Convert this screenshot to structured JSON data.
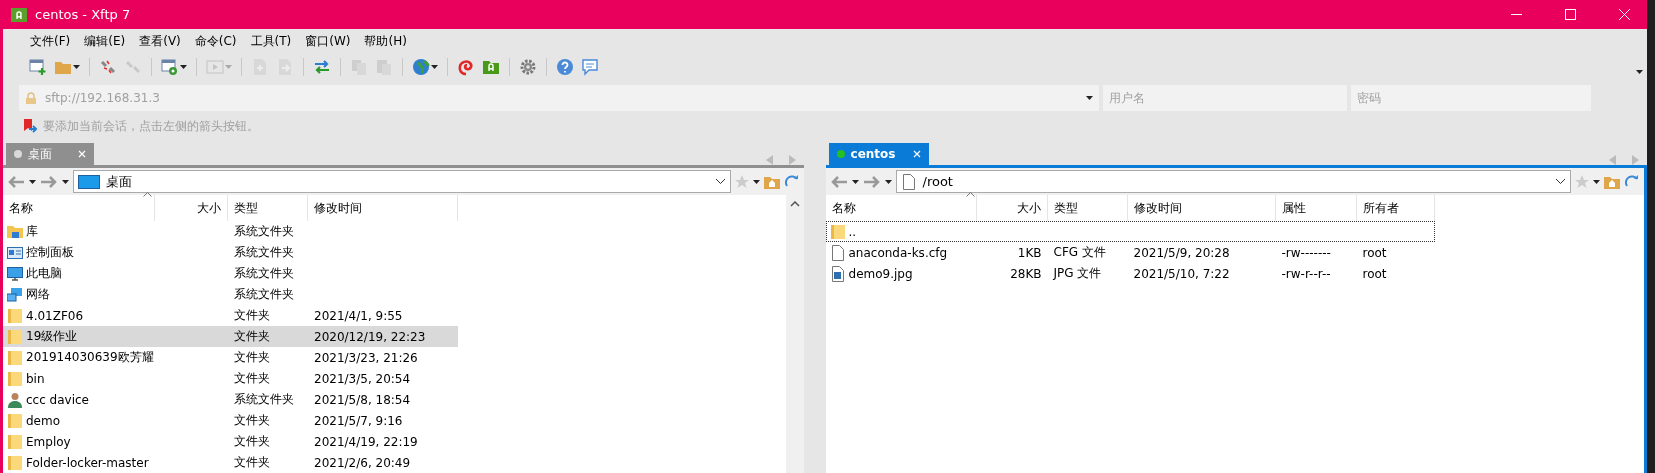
{
  "window": {
    "title": "centos - Xftp 7"
  },
  "menu": [
    "文件(F)",
    "编辑(E)",
    "查看(V)",
    "命令(C)",
    "工具(T)",
    "窗口(W)",
    "帮助(H)"
  ],
  "toolbar": [
    {
      "kind": "new-session",
      "disabled": false,
      "dropdown": false
    },
    {
      "kind": "open-folder",
      "disabled": false,
      "dropdown": true
    },
    {
      "kind": "separator"
    },
    {
      "kind": "disconnect",
      "disabled": false,
      "dropdown": false
    },
    {
      "kind": "reconnect",
      "disabled": true,
      "dropdown": false
    },
    {
      "kind": "separator"
    },
    {
      "kind": "properties",
      "disabled": false,
      "dropdown": true
    },
    {
      "kind": "separator"
    },
    {
      "kind": "play",
      "disabled": true,
      "dropdown": true
    },
    {
      "kind": "separator"
    },
    {
      "kind": "upload",
      "disabled": true,
      "dropdown": false
    },
    {
      "kind": "download",
      "disabled": true,
      "dropdown": false
    },
    {
      "kind": "separator"
    },
    {
      "kind": "transfer",
      "disabled": false,
      "dropdown": false
    },
    {
      "kind": "separator"
    },
    {
      "kind": "copy",
      "disabled": true,
      "dropdown": false
    },
    {
      "kind": "paste",
      "disabled": true,
      "dropdown": false
    },
    {
      "kind": "separator"
    },
    {
      "kind": "globe",
      "disabled": false,
      "dropdown": true
    },
    {
      "kind": "separator"
    },
    {
      "kind": "shell",
      "disabled": false,
      "dropdown": false
    },
    {
      "kind": "xftp",
      "disabled": false,
      "dropdown": false
    },
    {
      "kind": "separator"
    },
    {
      "kind": "settings",
      "disabled": false,
      "dropdown": false
    },
    {
      "kind": "separator"
    },
    {
      "kind": "help",
      "disabled": false,
      "dropdown": false
    },
    {
      "kind": "chat",
      "disabled": false,
      "dropdown": false
    }
  ],
  "address_bar": {
    "host": "sftp://192.168.31.3",
    "username_placeholder": "用户名",
    "password_placeholder": "密码"
  },
  "hint": "要添加当前会话，点击左侧的箭头按钮。",
  "panes": [
    {
      "tab": {
        "label": "桌面",
        "selected": false,
        "color": "#d9d9d9"
      },
      "path": {
        "kind": "desktop",
        "text": "桌面"
      },
      "columns": [
        "名称",
        "大小",
        "类型",
        "修改时间"
      ],
      "rows": [
        {
          "kind": "library",
          "name": "库",
          "size": "",
          "type": "系统文件夹",
          "modified": "",
          "selected": false
        },
        {
          "kind": "control-panel",
          "name": "控制面板",
          "size": "",
          "type": "系统文件夹",
          "modified": "",
          "selected": false
        },
        {
          "kind": "computer",
          "name": "此电脑",
          "size": "",
          "type": "系统文件夹",
          "modified": "",
          "selected": false
        },
        {
          "kind": "network",
          "name": "网络",
          "size": "",
          "type": "系统文件夹",
          "modified": "",
          "selected": false
        },
        {
          "kind": "folder",
          "name": "4.01ZF06",
          "size": "",
          "type": "文件夹",
          "modified": "2021/4/1, 9:55",
          "selected": false
        },
        {
          "kind": "folder",
          "name": "19级作业",
          "size": "",
          "type": "文件夹",
          "modified": "2020/12/19, 22:23",
          "selected": true
        },
        {
          "kind": "folder",
          "name": "201914030639欧芳耀",
          "size": "",
          "type": "文件夹",
          "modified": "2021/3/23, 21:26",
          "selected": false
        },
        {
          "kind": "folder",
          "name": "bin",
          "size": "",
          "type": "文件夹",
          "modified": "2021/3/5, 20:54",
          "selected": false
        },
        {
          "kind": "user",
          "name": "ccc davice",
          "size": "",
          "type": "系统文件夹",
          "modified": "2021/5/8, 18:54",
          "selected": false
        },
        {
          "kind": "folder",
          "name": "demo",
          "size": "",
          "type": "文件夹",
          "modified": "2021/5/7, 9:16",
          "selected": false
        },
        {
          "kind": "folder",
          "name": "Employ",
          "size": "",
          "type": "文件夹",
          "modified": "2021/4/19, 22:19",
          "selected": false
        },
        {
          "kind": "folder",
          "name": "Folder-locker-master",
          "size": "",
          "type": "文件夹",
          "modified": "2021/2/6, 20:49",
          "selected": false
        }
      ]
    },
    {
      "tab": {
        "label": "centos",
        "selected": true,
        "color": "#22c022"
      },
      "path": {
        "kind": "file",
        "text": "/root"
      },
      "columns": [
        "名称",
        "大小",
        "类型",
        "修改时间",
        "属性",
        "所有者"
      ],
      "rows": [
        {
          "kind": "folder",
          "name": "..",
          "size": "",
          "type": "",
          "modified": "",
          "attributes": "",
          "owner": "",
          "focused": true
        },
        {
          "kind": "file",
          "name": "anaconda-ks.cfg",
          "size": "1KB",
          "type": "CFG 文件",
          "modified": "2021/5/9, 20:28",
          "attributes": "-rw-------",
          "owner": "root",
          "focused": false
        },
        {
          "kind": "image",
          "name": "demo9.jpg",
          "size": "28KB",
          "type": "JPG 文件",
          "modified": "2021/5/10, 7:22",
          "attributes": "-rw-r--r--",
          "owner": "root",
          "focused": false
        }
      ]
    }
  ]
}
